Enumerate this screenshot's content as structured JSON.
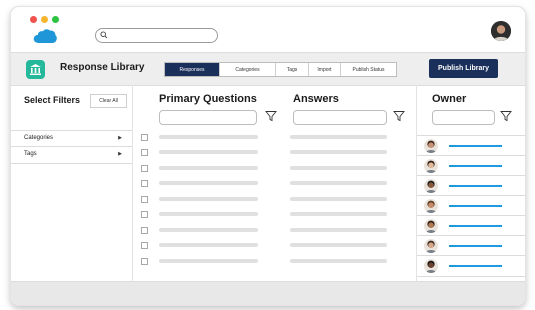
{
  "header": {
    "traffic_lights": [
      "#f0524e",
      "#f5b52e",
      "#2cc43e"
    ],
    "brand_color": "#1f96d8",
    "search": {
      "icon": "search-icon",
      "placeholder": ""
    }
  },
  "toolbar": {
    "app_icon": "bank-icon",
    "app_title": "Response Library",
    "tabs": [
      {
        "label": "Responses",
        "active": true
      },
      {
        "label": "Categories",
        "active": false
      },
      {
        "label": "Tags",
        "active": false
      },
      {
        "label": "Import",
        "active": false
      },
      {
        "label": "Publish Status",
        "active": false
      }
    ],
    "publish_label": "Publish Library"
  },
  "filters": {
    "title": "Select Filters",
    "clear_label": "Clear All",
    "items": [
      {
        "label": "Categories"
      },
      {
        "label": "Tags"
      }
    ]
  },
  "columns": {
    "primary_questions": "Primary Questions",
    "answers": "Answers",
    "owner": "Owner"
  },
  "colors": {
    "navy": "#1a2f5a",
    "accent_teal": "#26b89a",
    "owner_line": "#1e9be0",
    "placeholder_bar": "#e0e0e0"
  }
}
